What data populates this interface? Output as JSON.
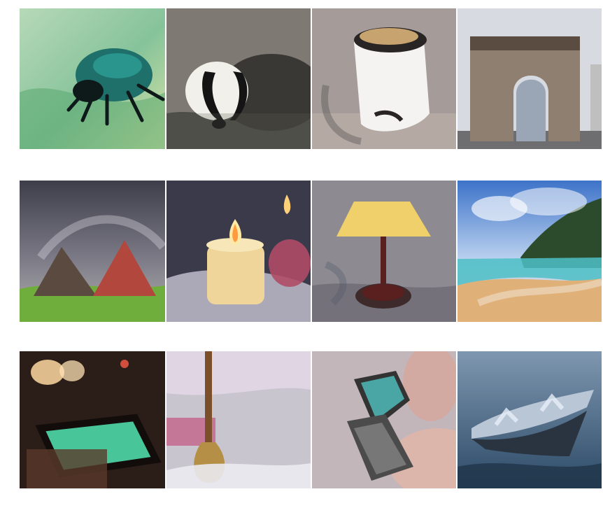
{
  "grid": {
    "rows": 3,
    "columns": 4,
    "tiles": [
      {
        "subject": "beetle",
        "colors": {
          "bg": "#9cc7a0",
          "accent": "#1f6f6a",
          "dark": "#10201f"
        }
      },
      {
        "subject": "badger",
        "colors": {
          "bg": "#7e7a73",
          "accent": "#f2f0ea",
          "dark": "#141414"
        }
      },
      {
        "subject": "toaster",
        "colors": {
          "bg": "#a59c9a",
          "accent": "#f4f3f2",
          "dark": "#2a2525"
        }
      },
      {
        "subject": "triumphal-arch",
        "colors": {
          "bg": "#d7dbe1",
          "accent": "#8e7f70",
          "dark": "#5b4c41"
        }
      },
      {
        "subject": "barn",
        "colors": {
          "bg": "#5a5a66",
          "accent": "#b1473d",
          "dark": "#3a2f2b"
        }
      },
      {
        "subject": "candle",
        "colors": {
          "bg": "#8a8799",
          "accent": "#f0d59a",
          "dark": "#3a3a4a"
        }
      },
      {
        "subject": "table-lamp",
        "colors": {
          "bg": "#8d8a92",
          "accent": "#efd06a",
          "dark": "#5a2020"
        }
      },
      {
        "subject": "beach",
        "colors": {
          "bg": "#5b88d6",
          "accent": "#e0b079",
          "dark": "#2c4a2c"
        }
      },
      {
        "subject": "pool-table",
        "colors": {
          "bg": "#2b1d17",
          "accent": "#49c59a",
          "dark": "#120c0a"
        }
      },
      {
        "subject": "broom",
        "colors": {
          "bg": "#c8c5cf",
          "accent": "#b58f45",
          "dark": "#7a4f2a"
        }
      },
      {
        "subject": "mobile-phone",
        "colors": {
          "bg": "#c2b6bb",
          "accent": "#4aa5a5",
          "dark": "#333333"
        }
      },
      {
        "subject": "aircraft-carrier",
        "colors": {
          "bg": "#4f6f8d",
          "accent": "#b9c6d6",
          "dark": "#2a3440"
        }
      }
    ]
  }
}
